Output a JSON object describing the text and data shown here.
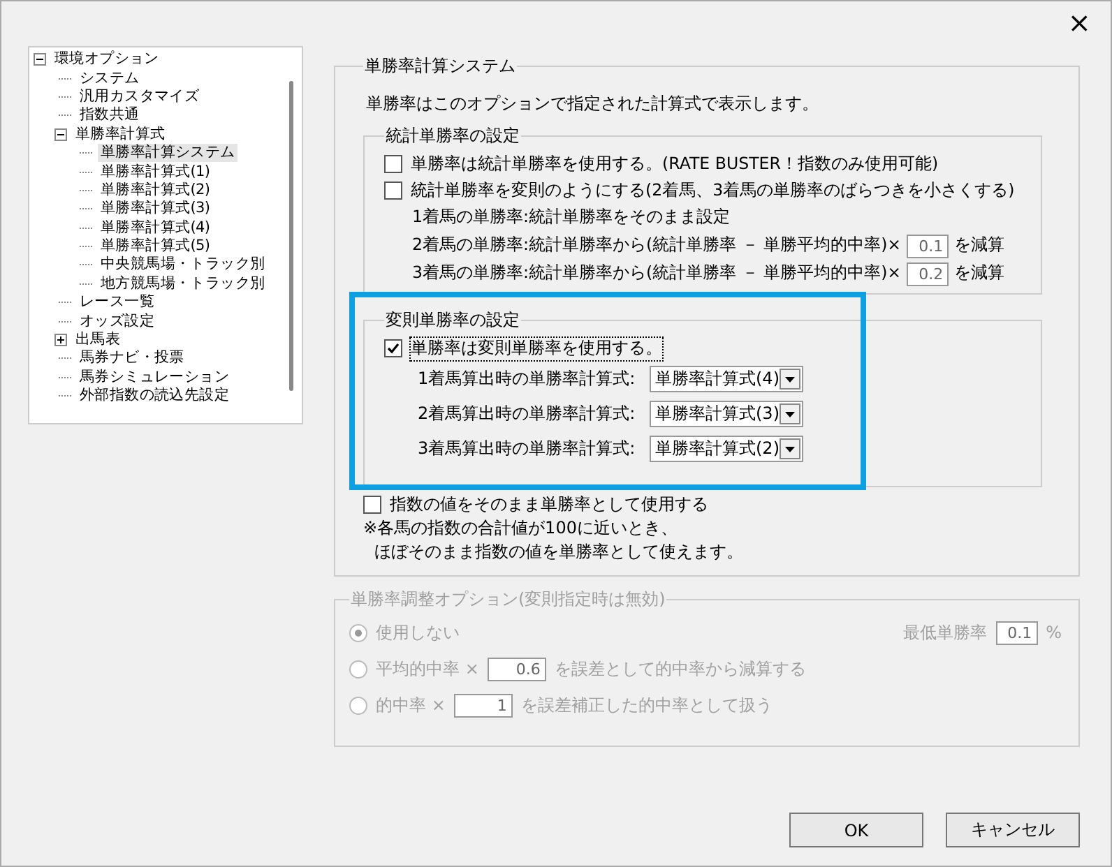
{
  "window": {
    "close": "×"
  },
  "tree": {
    "items": [
      {
        "label": "環境オプション",
        "expanded": true,
        "selected": false,
        "children": [
          {
            "label": "システム",
            "selected": false
          },
          {
            "label": "汎用カスタマイズ",
            "selected": false
          },
          {
            "label": "指数共通",
            "selected": false
          },
          {
            "label": "単勝率計算式",
            "expanded": true,
            "selected": false,
            "children": [
              {
                "label": "単勝率計算システム",
                "selected": true
              },
              {
                "label": "単勝率計算式(1)",
                "selected": false
              },
              {
                "label": "単勝率計算式(2)",
                "selected": false
              },
              {
                "label": "単勝率計算式(3)",
                "selected": false
              },
              {
                "label": "単勝率計算式(4)",
                "selected": false
              },
              {
                "label": "単勝率計算式(5)",
                "selected": false
              },
              {
                "label": "中央競馬場・トラック別",
                "selected": false
              },
              {
                "label": "地方競馬場・トラック別",
                "selected": false
              }
            ]
          },
          {
            "label": "レース一覧",
            "selected": false
          },
          {
            "label": "オッズ設定",
            "selected": false
          },
          {
            "label": "出馬表",
            "expanded": false,
            "selected": false
          },
          {
            "label": "馬券ナビ・投票",
            "selected": false
          },
          {
            "label": "馬券シミュレーション",
            "selected": false
          },
          {
            "label": "外部指数の読込先設定",
            "selected": false
          }
        ]
      }
    ]
  },
  "system_group": {
    "title": "単勝率計算システム",
    "description": "単勝率はこのオプションで指定された計算式で表示します。",
    "stat_group": {
      "title": "統計単勝率の設定",
      "options": [
        {
          "label": "単勝率は統計単勝率を使用する。(RATE BUSTER！指数のみ使用可能)",
          "checked": false
        },
        {
          "label": "統計単勝率を変則のようにする(2着馬、3着馬の単勝率のばらつきを小さくする)",
          "checked": false
        }
      ],
      "notes": [
        {
          "text": "1着馬の単勝率:統計単勝率をそのまま設定"
        },
        {
          "text": "2着馬の単勝率:統計単勝率から(統計単勝率 － 単勝平均的中率)×",
          "value": "0.1",
          "suffix": "を減算"
        },
        {
          "text": "3着馬の単勝率:統計単勝率から(統計単勝率 － 単勝平均的中率)×",
          "value": "0.2",
          "suffix": "を減算"
        }
      ]
    },
    "variant_group": {
      "title": "変則単勝率の設定",
      "highlighted": true,
      "option": {
        "label": "単勝率は変則単勝率を使用する。",
        "checked": true
      },
      "formulas": [
        {
          "label": "1着馬算出時の単勝率計算式:",
          "value": "単勝率計算式(4)"
        },
        {
          "label": "2着馬算出時の単勝率計算式:",
          "value": "単勝率計算式(3)"
        },
        {
          "label": "3着馬算出時の単勝率計算式:",
          "value": "単勝率計算式(2)"
        }
      ]
    },
    "index_option": {
      "label": "指数の値をそのまま単勝率として使用する",
      "checked": false
    },
    "notes": [
      "※各馬の指数の合計値が100に近いとき、",
      "ほぼそのまま指数の値を単勝率として使えます。"
    ]
  },
  "adjust_group": {
    "title": "単勝率調整オプション(変則指定時は無効)",
    "disabled": true,
    "radios": [
      {
        "label": "使用しない",
        "selected": true
      },
      {
        "prefix": "平均的中率 ×",
        "value": "0.6",
        "label": "を誤差として的中率から減算する",
        "selected": false
      },
      {
        "prefix": "的中率 ×",
        "value": "1",
        "label": "を誤差補正した的中率として扱う",
        "selected": false
      }
    ],
    "min_rate": {
      "label": "最低単勝率",
      "value": "0.1",
      "unit": "%"
    }
  },
  "buttons": [
    {
      "label": "OK"
    },
    {
      "label": "キャンセル"
    }
  ]
}
